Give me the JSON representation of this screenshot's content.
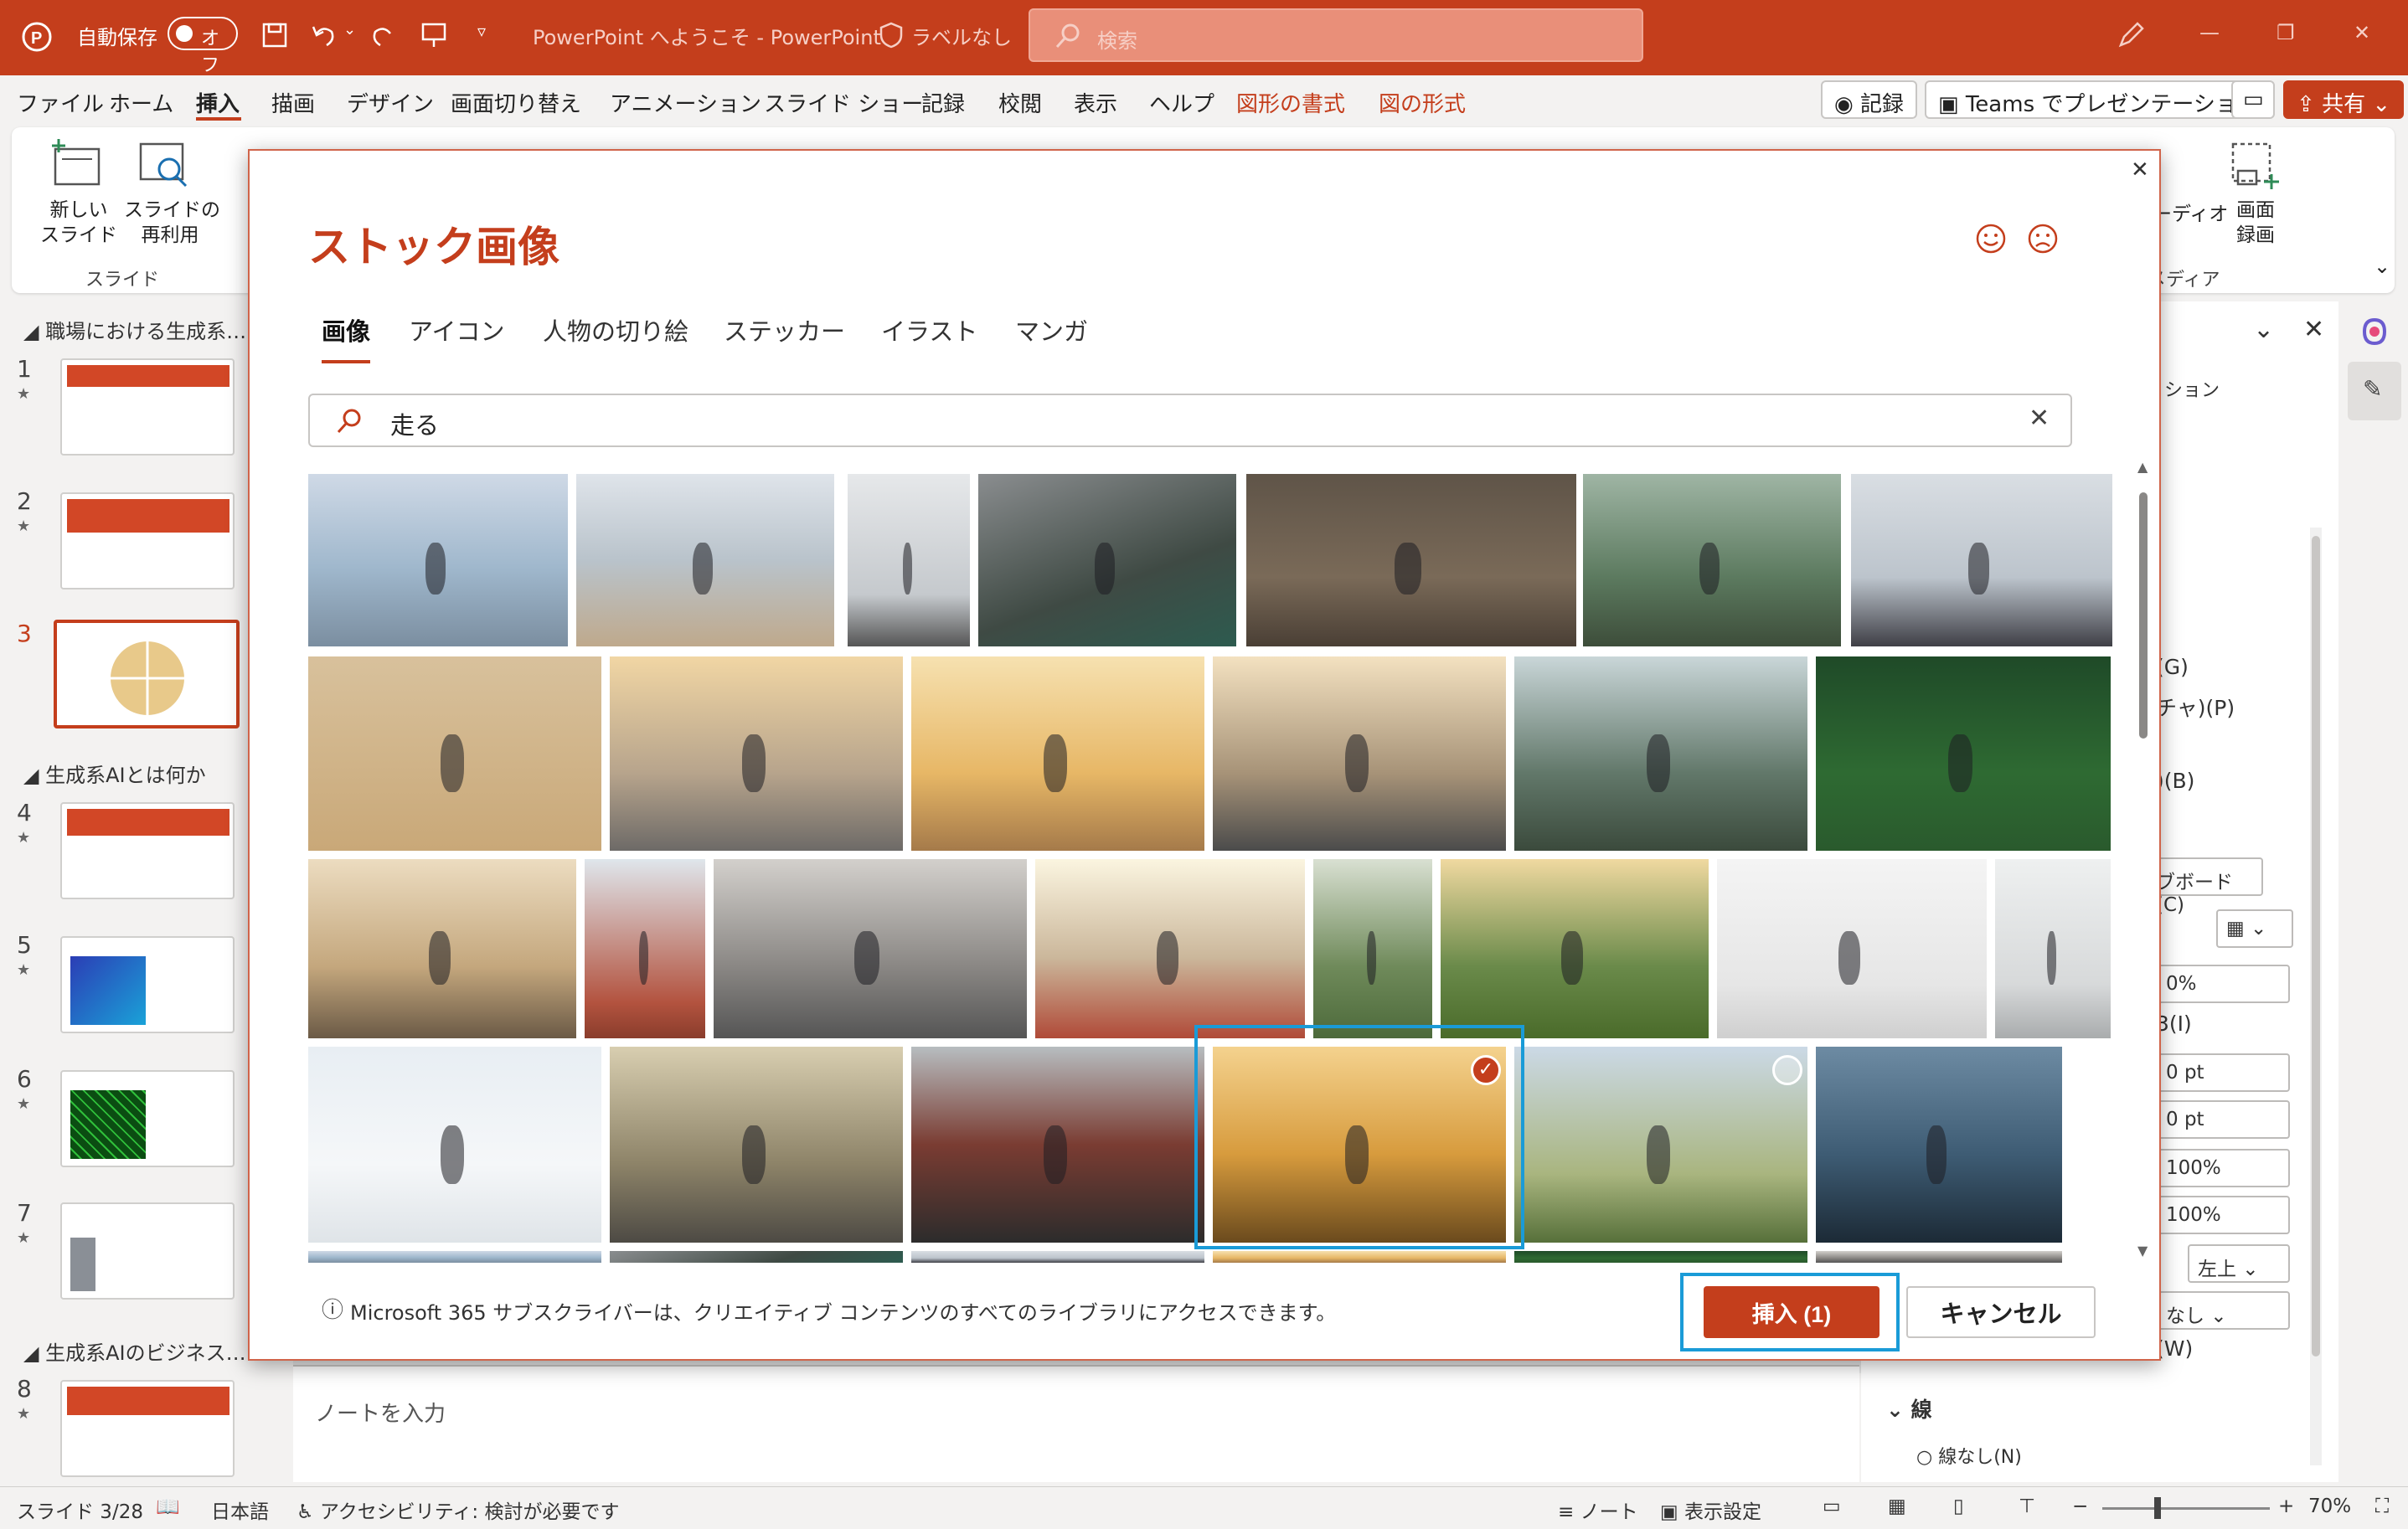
{
  "titlebar": {
    "autosave_label": "自動保存",
    "autosave_state": "オフ",
    "doc_title": "PowerPoint へようこそ  -  PowerPoint",
    "sensitivity": "ラベルなし",
    "search_placeholder": "検索"
  },
  "menu": {
    "items": [
      "ファイル",
      "ホーム",
      "挿入",
      "描画",
      "デザイン",
      "画面切り替え",
      "アニメーション",
      "スライド ショー",
      "記録",
      "校閲",
      "表示",
      "ヘルプ",
      "図形の書式",
      "図の形式"
    ],
    "record_button": "記録",
    "teams_button": "Teams でプレゼンテーション",
    "share_button": "共有"
  },
  "ribbon": {
    "new_slide": "新しい\nスライド",
    "reuse_slide": "スライドの\n再利用",
    "group_slides": "スライド",
    "media_partial": "ーディオ",
    "screen_record": "画面\n録画",
    "media_group": "メディア"
  },
  "slides": {
    "sections": [
      "職場における生成系…",
      "生成系AIとは何か",
      "生成系AIのビジネス…"
    ],
    "numbers": [
      "1",
      "2",
      "3",
      "4",
      "5",
      "6",
      "7",
      "8"
    ]
  },
  "notes": {
    "placeholder": "ノートを入力"
  },
  "dialog": {
    "title": "ストック画像",
    "tabs": [
      "画像",
      "アイコン",
      "人物の切り絵",
      "ステッカー",
      "イラスト",
      "マンガ"
    ],
    "search_query": "走る",
    "info": "Microsoft 365 サブスクライバーは、クリエイティブ コンテンツのすべてのライブラリにアクセスできます。",
    "insert_button": "挿入 (1)",
    "cancel_button": "キャンセル",
    "images": [
      {
        "desc": "runner-on-pier"
      },
      {
        "desc": "runner-on-beach"
      },
      {
        "desc": "jumper-on-track"
      },
      {
        "desc": "runner-bridge"
      },
      {
        "desc": "soccer-players"
      },
      {
        "desc": "two-runners-hug"
      },
      {
        "desc": "senior-woman-runner"
      },
      {
        "desc": "runner-on-sand"
      },
      {
        "desc": "stretching-leg"
      },
      {
        "desc": "surfers-beach"
      },
      {
        "desc": "runner-city-view"
      },
      {
        "desc": "man-jogging"
      },
      {
        "desc": "soccer-ball-kick"
      },
      {
        "desc": "runner-hill"
      },
      {
        "desc": "runner-on-track"
      },
      {
        "desc": "tying-shoes"
      },
      {
        "desc": "stretching-track"
      },
      {
        "desc": "woman-running-park"
      },
      {
        "desc": "girl-tutu-grass"
      },
      {
        "desc": "woman-sprint-studio"
      },
      {
        "desc": "runner-stairs"
      },
      {
        "desc": "runner-in-snow"
      },
      {
        "desc": "shoes-on-floor"
      },
      {
        "desc": "stretching-red-jacket"
      },
      {
        "desc": "runner-feet-sunset"
      },
      {
        "desc": "man-running-field"
      },
      {
        "desc": "swimmers-sea"
      }
    ]
  },
  "right_pane": {
    "items": [
      "ション",
      "(G)",
      "チャ)(P)",
      ")(B)",
      "ブボード(C)",
      "0%",
      "3(I)",
      "0 pt",
      "0 pt",
      "100%",
      "100%",
      "左上",
      "なし",
      "(W)",
      "線",
      "線なし(N)"
    ]
  },
  "status": {
    "slide_info": "スライド 3/28",
    "language": "日本語",
    "accessibility": "アクセシビリティ: 検討が必要です",
    "notes": "ノート",
    "display_settings": "表示設定",
    "zoom": "70%"
  },
  "colors": {
    "brand": "#c43e1c",
    "selection": "#1a9bd7"
  }
}
